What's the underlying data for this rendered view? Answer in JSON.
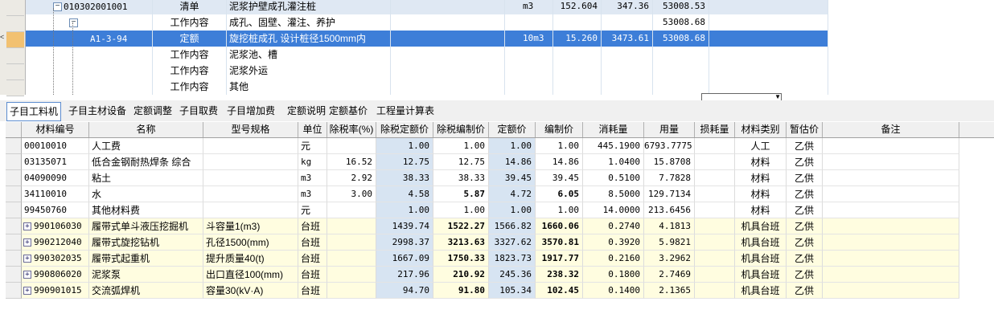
{
  "tree": {
    "rows": [
      {
        "code": "010302001001",
        "type": "清单",
        "name": "泥浆护壁成孔灌注桩",
        "unit": "m3",
        "qty": "152.604",
        "price": "347.36",
        "total": "53008.53",
        "style": "blue"
      },
      {
        "code": "",
        "type": "工作内容",
        "name": "成孔、固壁、灌注、养护",
        "unit": "",
        "qty": "",
        "price": "",
        "total": "53008.68",
        "style": "white"
      },
      {
        "code": "A1-3-94",
        "type": "定额",
        "name": "旋挖桩成孔 设计桩径1500mm内",
        "unit": "10m3",
        "qty": "15.260",
        "price": "3473.61",
        "total": "53008.68",
        "style": "sel"
      },
      {
        "code": "",
        "type": "工作内容",
        "name": "泥浆池、槽",
        "unit": "",
        "qty": "",
        "price": "",
        "total": "",
        "style": "white"
      },
      {
        "code": "",
        "type": "工作内容",
        "name": "泥浆外运",
        "unit": "",
        "qty": "",
        "price": "",
        "total": "",
        "style": "white"
      },
      {
        "code": "",
        "type": "工作内容",
        "name": "其他",
        "unit": "",
        "qty": "",
        "price": "",
        "total": "",
        "style": "white"
      }
    ]
  },
  "tabs": [
    "子目工料机",
    "子目主材设备",
    "定额调整",
    "子目取费",
    "子目增加费",
    "定额说明",
    "定额基价",
    "工程量计算表"
  ],
  "grid": {
    "headers": [
      "材料编号",
      "名称",
      "型号规格",
      "单位",
      "除税率(%)",
      "除税定额价",
      "除税编制价",
      "定额价",
      "编制价",
      "消耗量",
      "用量",
      "损耗量",
      "材料类别",
      "暂估价",
      "备注"
    ],
    "rows": [
      {
        "code": "00010010",
        "name": "人工费",
        "spec": "",
        "unit": "元",
        "rate": "",
        "dprice": "1.00",
        "bprice": "1.00",
        "dj": "1.00",
        "bj": "1.00",
        "xh": "445.1900",
        "yl": "6793.7775",
        "sh": "",
        "cat": "人工",
        "zg": "乙供",
        "bz": "",
        "machine": false,
        "boldB": false
      },
      {
        "code": "03135071",
        "name": "低合金钢耐热焊条 综合",
        "spec": "",
        "unit": "kg",
        "rate": "16.52",
        "dprice": "12.75",
        "bprice": "12.75",
        "dj": "14.86",
        "bj": "14.86",
        "xh": "1.0400",
        "yl": "15.8708",
        "sh": "",
        "cat": "材料",
        "zg": "乙供",
        "bz": "",
        "machine": false,
        "boldB": false
      },
      {
        "code": "04090090",
        "name": "粘土",
        "spec": "",
        "unit": "m3",
        "rate": "2.92",
        "dprice": "38.33",
        "bprice": "38.33",
        "dj": "39.45",
        "bj": "39.45",
        "xh": "0.5100",
        "yl": "7.7828",
        "sh": "",
        "cat": "材料",
        "zg": "乙供",
        "bz": "",
        "machine": false,
        "boldB": false
      },
      {
        "code": "34110010",
        "name": "水",
        "spec": "",
        "unit": "m3",
        "rate": "3.00",
        "dprice": "4.58",
        "bprice": "5.87",
        "dj": "4.72",
        "bj": "6.05",
        "xh": "8.5000",
        "yl": "129.7134",
        "sh": "",
        "cat": "材料",
        "zg": "乙供",
        "bz": "",
        "machine": false,
        "boldB": true
      },
      {
        "code": "99450760",
        "name": "其他材料费",
        "spec": "",
        "unit": "元",
        "rate": "",
        "dprice": "1.00",
        "bprice": "1.00",
        "dj": "1.00",
        "bj": "1.00",
        "xh": "14.0000",
        "yl": "213.6456",
        "sh": "",
        "cat": "材料",
        "zg": "乙供",
        "bz": "",
        "machine": false,
        "boldB": false
      },
      {
        "code": "990106030",
        "name": "履带式单斗液压挖掘机",
        "spec": "斗容量1(m3)",
        "unit": "台班",
        "rate": "",
        "dprice": "1439.74",
        "bprice": "1522.27",
        "dj": "1566.82",
        "bj": "1660.06",
        "xh": "0.2740",
        "yl": "4.1813",
        "sh": "",
        "cat": "机具台班",
        "zg": "乙供",
        "bz": "",
        "machine": true,
        "boldB": true
      },
      {
        "code": "990212040",
        "name": "履带式旋挖钻机",
        "spec": "孔径1500(mm)",
        "unit": "台班",
        "rate": "",
        "dprice": "2998.37",
        "bprice": "3213.63",
        "dj": "3327.62",
        "bj": "3570.81",
        "xh": "0.3920",
        "yl": "5.9821",
        "sh": "",
        "cat": "机具台班",
        "zg": "乙供",
        "bz": "",
        "machine": true,
        "boldB": true
      },
      {
        "code": "990302035",
        "name": "履带式起重机",
        "spec": "提升质量40(t)",
        "unit": "台班",
        "rate": "",
        "dprice": "1667.09",
        "bprice": "1750.33",
        "dj": "1823.73",
        "bj": "1917.77",
        "xh": "0.2160",
        "yl": "3.2962",
        "sh": "",
        "cat": "机具台班",
        "zg": "乙供",
        "bz": "",
        "machine": true,
        "boldB": true
      },
      {
        "code": "990806020",
        "name": "泥浆泵",
        "spec": "出口直径100(mm)",
        "unit": "台班",
        "rate": "",
        "dprice": "217.96",
        "bprice": "210.92",
        "dj": "245.36",
        "bj": "238.32",
        "xh": "0.1800",
        "yl": "2.7469",
        "sh": "",
        "cat": "机具台班",
        "zg": "乙供",
        "bz": "",
        "machine": true,
        "boldB": true
      },
      {
        "code": "990901015",
        "name": "交流弧焊机",
        "spec": "容量30(kV·A)",
        "unit": "台班",
        "rate": "",
        "dprice": "94.70",
        "bprice": "91.80",
        "dj": "105.34",
        "bj": "102.45",
        "xh": "0.1400",
        "yl": "2.1365",
        "sh": "",
        "cat": "机具台班",
        "zg": "乙供",
        "bz": "",
        "machine": true,
        "boldB": true
      }
    ]
  }
}
